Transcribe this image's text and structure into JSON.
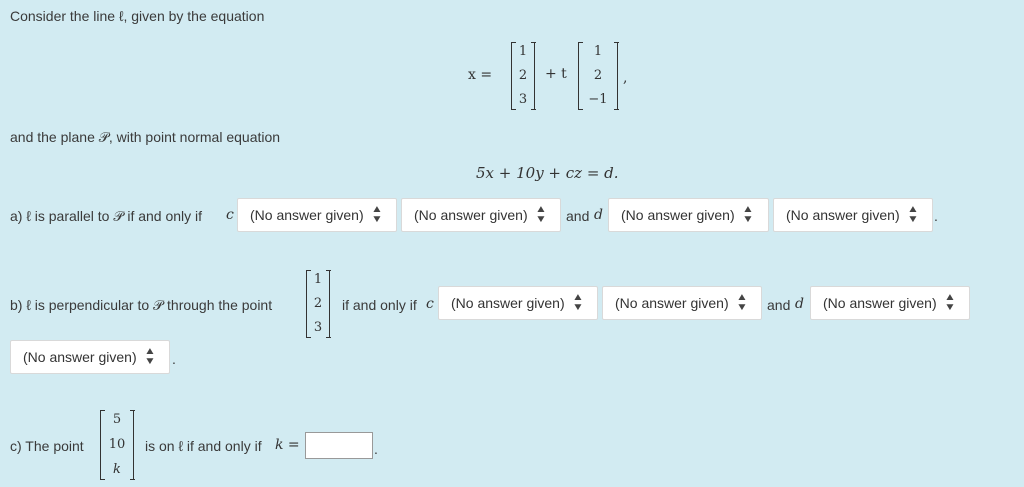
{
  "intro": {
    "line_text": "Consider the line ℓ, given by the equation",
    "plane_text": "and the plane 𝒫, with point normal equation"
  },
  "line_eq": {
    "x_label": "x =",
    "point": [
      "1",
      "2",
      "3"
    ],
    "plus_t": "+ t",
    "direction": [
      "1",
      "2",
      "−1"
    ],
    "comma": ","
  },
  "plane_eq": "5x + 10y + cz = d.",
  "part_a": {
    "prefix": "a) ℓ is parallel to 𝒫 if and only if",
    "c": "c",
    "and_d": "and",
    "d": "d",
    "end": ".",
    "selects": [
      "(No answer given)",
      "(No answer given)",
      "(No answer given)",
      "(No answer given)"
    ]
  },
  "part_b": {
    "prefix": "b) ℓ is perpendicular to 𝒫 through the point",
    "point": [
      "1",
      "2",
      "3"
    ],
    "iff": "if and only if",
    "c": "c",
    "and_d": "and",
    "d": "d",
    "end": ".",
    "selects": [
      "(No answer given)",
      "(No answer given)",
      "(No answer given)",
      "(No answer given)"
    ]
  },
  "part_c": {
    "prefix": "c) The point",
    "point": [
      "5",
      "10",
      "k"
    ],
    "suffix": "is on ℓ if and only if",
    "k_eq": "k =",
    "end": ".",
    "input_value": ""
  }
}
